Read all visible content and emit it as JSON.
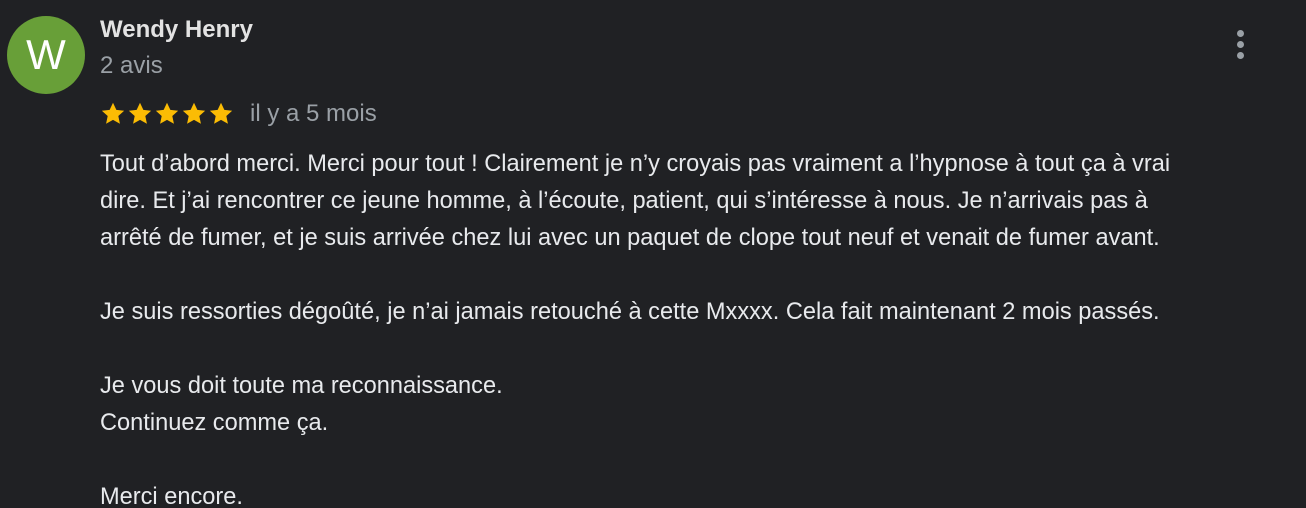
{
  "review": {
    "avatar_letter": "W",
    "avatar_color": "#689f38",
    "author": "Wendy Henry",
    "review_count": "2 avis",
    "rating": 5,
    "rating_max": 5,
    "star_color": "#fbbc04",
    "time": "il y a 5 mois",
    "menu_icon": "more-vert-icon",
    "paragraphs": [
      [
        "Tout d’abord merci. Merci pour tout ! Clairement je n’y croyais pas vraiment a l’hypnose à tout ça à vrai",
        "dire. Et j’ai rencontrer ce jeune homme, à l’écoute, patient, qui s’intéresse à nous. Je n’arrivais pas à",
        "arrêté de fumer, et je suis arrivée chez lui avec un paquet de clope tout neuf et venait de fumer avant."
      ],
      [
        "Je suis ressorties dégoûté, je n’ai jamais retouché à cette Mxxxx. Cela fait maintenant 2 mois passés."
      ],
      [
        "Je vous doit toute ma reconnaissance.",
        "Continuez comme ça."
      ],
      [
        "Merci encore."
      ]
    ]
  }
}
